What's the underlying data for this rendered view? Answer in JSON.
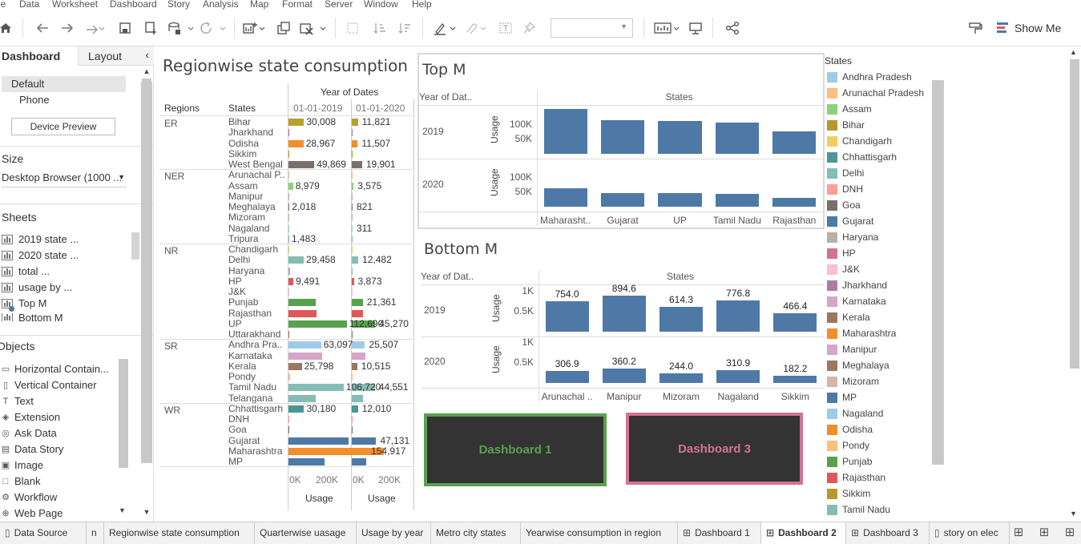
{
  "menu": [
    "le",
    "Data",
    "Worksheet",
    "Dashboard",
    "Story",
    "Analysis",
    "Map",
    "Format",
    "Server",
    "Window",
    "Help"
  ],
  "toolbar": {
    "show_me": "Show Me",
    "icons": [
      "home-icon",
      "undo-icon",
      "redo-icon",
      "replay-icon",
      "save-icon",
      "new-datasource-icon",
      "pause-updates-icon",
      "refresh-icon",
      "new-worksheet-icon",
      "duplicate-sheet-icon",
      "clear-sheet-icon",
      "group-icon",
      "sort-ascending-icon",
      "sort-descending-icon",
      "highlight-icon",
      "attach-icon",
      "label-icon",
      "pin-icon",
      "fit-icon",
      "presentation-icon",
      "share-icon",
      "format-painter-icon"
    ]
  },
  "left_panel": {
    "tab_dashboard": "Dashboard",
    "tab_layout": "Layout",
    "collapse": "‹",
    "devices": [
      "Default",
      "Phone"
    ],
    "device_preview": "Device Preview",
    "size_heading": "Size",
    "size_value": "Desktop Browser (1000 ...",
    "sheets_heading": "Sheets",
    "sheets": [
      "2019 state ...",
      "2020 state ...",
      "total ...",
      "usage by ...",
      "Top M",
      "Bottom M"
    ],
    "objects_heading": "Objects",
    "objects": [
      "Horizontal Contain...",
      "Vertical Container",
      "Text",
      "Extension",
      "Ask Data",
      "Data Story",
      "Image",
      "Blank",
      "Workflow",
      "Web Page"
    ],
    "object_icons": [
      "horizontal-container-icon",
      "vertical-container-icon",
      "text-icon",
      "extension-icon",
      "ask-data-icon",
      "data-story-icon",
      "image-icon",
      "blank-icon",
      "workflow-icon",
      "web-page-icon"
    ]
  },
  "regionwise": {
    "title": "Regionwise state consumption",
    "year_header": "Year of Dates",
    "col_regions": "Regions",
    "col_states": "States",
    "col_2019": "01-01-2019",
    "col_2020": "01-01-2020",
    "axis_ticks_2019": [
      "0K",
      "200K"
    ],
    "axis_ticks_2020": [
      "0K",
      "200K"
    ],
    "axis_label_2019": "Usage",
    "axis_label_2020": "Usage",
    "regions": [
      {
        "name": "ER",
        "rows": [
          {
            "state": "Bihar",
            "color": "#b8a02c",
            "v2019": 30008,
            "v2020": 11821,
            "show2019": "30,008",
            "show2020": "11,821"
          },
          {
            "state": "Jharkhand",
            "color": "#b07aa1",
            "v2019": 1500,
            "v2020": 600,
            "show2019": "",
            "show2020": ""
          },
          {
            "state": "Odisha",
            "color": "#f28e2b",
            "v2019": 28967,
            "v2020": 11507,
            "show2019": "28,967",
            "show2020": "11,507"
          },
          {
            "state": "Sikkim",
            "color": "#b8a02c",
            "v2019": 400,
            "v2020": 180,
            "show2019": "",
            "show2020": ""
          },
          {
            "state": "West Bengal",
            "color": "#79706e",
            "v2019": 49869,
            "v2020": 19901,
            "show2019": "49,869",
            "show2020": "19,901"
          }
        ]
      },
      {
        "name": "NER",
        "rows": [
          {
            "state": "Arunachal P..",
            "color": "#ffbe7d",
            "v2019": 300,
            "v2020": 150,
            "show2019": "",
            "show2020": ""
          },
          {
            "state": "Assam",
            "color": "#8cd17d",
            "v2019": 8979,
            "v2020": 3575,
            "show2019": "8,979",
            "show2020": "3,575"
          },
          {
            "state": "Manipur",
            "color": "#d4a6c8",
            "v2019": 350,
            "v2020": 150,
            "show2019": "",
            "show2020": ""
          },
          {
            "state": "Meghalaya",
            "color": "#9d7660",
            "v2019": 2018,
            "v2020": 821,
            "show2019": "2,018",
            "show2020": "821"
          },
          {
            "state": "Mizoram",
            "color": "#d7b5a6",
            "v2019": 240,
            "v2020": 100,
            "show2019": "",
            "show2020": ""
          },
          {
            "state": "Nagaland",
            "color": "#a0cbe8",
            "v2019": 300,
            "v2020": 311,
            "show2019": "",
            "show2020": "311"
          },
          {
            "state": "Tripura",
            "color": "#86bcb6",
            "v2019": 1483,
            "v2020": 600,
            "show2019": "1,483",
            "show2020": ""
          }
        ]
      },
      {
        "name": "NR",
        "rows": [
          {
            "state": "Chandigarh",
            "color": "#f1ce63",
            "v2019": 1500,
            "v2020": 600,
            "show2019": "",
            "show2020": ""
          },
          {
            "state": "Delhi",
            "color": "#86bcb6",
            "v2019": 29458,
            "v2020": 12482,
            "show2019": "29,458",
            "show2020": "12,482"
          },
          {
            "state": "Haryana",
            "color": "#bab0ac",
            "v2019": 2500,
            "v2020": 1000,
            "show2019": "",
            "show2020": ""
          },
          {
            "state": "HP",
            "color": "#e15759",
            "v2019": 9491,
            "v2020": 3873,
            "show2019": "9,491",
            "show2020": "3,873"
          },
          {
            "state": "J&K",
            "color": "#fabfd2",
            "v2019": 2000,
            "v2020": 800,
            "show2019": "",
            "show2020": ""
          },
          {
            "state": "Punjab",
            "color": "#59a14f",
            "v2019": 52000,
            "v2020": 21361,
            "show2019": "",
            "show2020": "21,361"
          },
          {
            "state": "Rajasthan",
            "color": "#e15759",
            "v2019": 54000,
            "v2020": 22000,
            "show2019": "",
            "show2020": ""
          },
          {
            "state": "UP",
            "color": "#59a14f",
            "v2019": 112690,
            "v2020": 45270,
            "show2019": "112,690",
            "show2020": "45,270"
          },
          {
            "state": "Uttarakhand",
            "color": "#9d7660",
            "v2019": 2000,
            "v2020": 800,
            "show2019": "",
            "show2020": ""
          }
        ]
      },
      {
        "name": "SR",
        "rows": [
          {
            "state": "Andhra Pra..",
            "color": "#a0cbe8",
            "v2019": 63097,
            "v2020": 25507,
            "show2019": "63,097",
            "show2020": "25,507"
          },
          {
            "state": "Karnataka",
            "color": "#d4a6c8",
            "v2019": 65000,
            "v2020": 26000,
            "show2019": "",
            "show2020": ""
          },
          {
            "state": "Kerala",
            "color": "#9d7660",
            "v2019": 25798,
            "v2020": 10515,
            "show2019": "25,798",
            "show2020": "10,515"
          },
          {
            "state": "Pondy",
            "color": "#ffbe7d",
            "v2019": 2500,
            "v2020": 1000,
            "show2019": "",
            "show2020": ""
          },
          {
            "state": "Tamil Nadu",
            "color": "#86bcb6",
            "v2019": 106720,
            "v2020": 44551,
            "show2019": "106,720",
            "show2020": "44,551"
          },
          {
            "state": "Telangana",
            "color": "#86bcb6",
            "v2019": 52000,
            "v2020": 21000,
            "show2019": "",
            "show2020": ""
          }
        ]
      },
      {
        "name": "WR",
        "rows": [
          {
            "state": "Chhattisgarh",
            "color": "#499894",
            "v2019": 30180,
            "v2020": 12010,
            "show2019": "30,180",
            "show2020": "12,010"
          },
          {
            "state": "DNH",
            "color": "#ff9d9a",
            "v2019": 500,
            "v2020": 200,
            "show2019": "",
            "show2020": ""
          },
          {
            "state": "Goa",
            "color": "#79706e",
            "v2019": 600,
            "v2020": 250,
            "show2019": "",
            "show2020": ""
          },
          {
            "state": "Gujarat",
            "color": "#4e79a7",
            "v2019": 116000,
            "v2020": 47131,
            "show2019": "",
            "show2020": "47,131"
          },
          {
            "state": "Maharashtra",
            "color": "#f28e2b",
            "v2019": 154917,
            "v2020": 62000,
            "show2019": "154,917",
            "show2020": ""
          },
          {
            "state": "MP",
            "color": "#4e79a7",
            "v2019": 70000,
            "v2020": 28000,
            "show2019": "",
            "show2020": ""
          }
        ]
      }
    ]
  },
  "top_m": {
    "title": "Top M",
    "col_year": "Year of Dat..",
    "col_states": "States",
    "y_label": "Usage",
    "ticks": [
      "100K",
      "50K"
    ],
    "years": [
      "2019",
      "2020"
    ],
    "categories": [
      "Maharasht..",
      "Gujarat",
      "UP",
      "Tamil Nadu",
      "Rajasthan"
    ]
  },
  "bottom_m": {
    "title": "Bottom M",
    "col_year": "Year of Dat..",
    "col_states": "States",
    "y_label": "Usage",
    "ticks": [
      "1K",
      "0.5K"
    ],
    "years": [
      "2019",
      "2020"
    ],
    "categories": [
      "Arunachal ..",
      "Manipur",
      "Mizoram",
      "Nagaland",
      "Sikkim"
    ]
  },
  "chart_data": [
    {
      "type": "bar",
      "title": "Top M",
      "xlabel": "States",
      "ylabel": "Usage",
      "categories": [
        "Maharasht..",
        "Gujarat",
        "UP",
        "Tamil Nadu",
        "Rajasthan"
      ],
      "series": [
        {
          "name": "2019",
          "values": [
            154917,
            116000,
            112690,
            106720,
            77000
          ]
        },
        {
          "name": "2020",
          "values": [
            62000,
            47131,
            45270,
            44551,
            30000
          ]
        }
      ],
      "ylim": [
        0,
        170000
      ]
    },
    {
      "type": "bar",
      "title": "Bottom M",
      "xlabel": "States",
      "ylabel": "Usage",
      "categories": [
        "Arunachal ..",
        "Manipur",
        "Mizoram",
        "Nagaland",
        "Sikkim"
      ],
      "series": [
        {
          "name": "2019",
          "values": [
            754.0,
            894.6,
            614.3,
            776.8,
            466.4
          ],
          "labels": [
            "754.0",
            "894.6",
            "614.3",
            "776.8",
            "466.4"
          ]
        },
        {
          "name": "2020",
          "values": [
            306.9,
            360.2,
            244.0,
            310.9,
            182.2
          ],
          "labels": [
            "306.9",
            "360.2",
            "244.0",
            "310.9",
            "182.2"
          ]
        }
      ],
      "ylim": [
        0,
        1100
      ]
    }
  ],
  "buttons": [
    {
      "label": "Dashboard 1",
      "color": "#59a14f"
    },
    {
      "label": "Dashboard 3",
      "color": "#d37295"
    }
  ],
  "legend": {
    "title": "States",
    "items": [
      {
        "label": "Andhra Pradesh",
        "color": "#a0cbe8"
      },
      {
        "label": "Arunachal Pradesh",
        "color": "#ffbe7d"
      },
      {
        "label": "Assam",
        "color": "#8cd17d"
      },
      {
        "label": "Bihar",
        "color": "#b6992d"
      },
      {
        "label": "Chandigarh",
        "color": "#f1ce63"
      },
      {
        "label": "Chhattisgarh",
        "color": "#499894"
      },
      {
        "label": "Delhi",
        "color": "#86bcb6"
      },
      {
        "label": "DNH",
        "color": "#ff9d9a"
      },
      {
        "label": "Goa",
        "color": "#79706e"
      },
      {
        "label": "Gujarat",
        "color": "#4e79a7"
      },
      {
        "label": "Haryana",
        "color": "#bab0ac"
      },
      {
        "label": "HP",
        "color": "#d37295"
      },
      {
        "label": "J&K",
        "color": "#fabfd2"
      },
      {
        "label": "Jharkhand",
        "color": "#b07aa1"
      },
      {
        "label": "Karnataka",
        "color": "#d4a6c8"
      },
      {
        "label": "Kerala",
        "color": "#9d7660"
      },
      {
        "label": "Maharashtra",
        "color": "#f28e2b"
      },
      {
        "label": "Manipur",
        "color": "#d4a6c8"
      },
      {
        "label": "Meghalaya",
        "color": "#9d7660"
      },
      {
        "label": "Mizoram",
        "color": "#d7b5a6"
      },
      {
        "label": "MP",
        "color": "#4e79a7"
      },
      {
        "label": "Nagaland",
        "color": "#a0cbe8"
      },
      {
        "label": "Odisha",
        "color": "#f28e2b"
      },
      {
        "label": "Pondy",
        "color": "#ffbe7d"
      },
      {
        "label": "Punjab",
        "color": "#59a14f"
      },
      {
        "label": "Rajasthan",
        "color": "#e15759"
      },
      {
        "label": "Sikkim",
        "color": "#b6992d"
      },
      {
        "label": "Tamil Nadu",
        "color": "#86bcb6"
      }
    ]
  },
  "bottom_tabs": [
    {
      "label": "Data Source",
      "icon": "database-icon"
    },
    {
      "label": "n",
      "icon": ""
    },
    {
      "label": "Regionwise state consumption",
      "icon": ""
    },
    {
      "label": "Quarterwise uasage",
      "icon": ""
    },
    {
      "label": "Usage by year",
      "icon": ""
    },
    {
      "label": "Metro city states",
      "icon": ""
    },
    {
      "label": "Yearwise consumption in region",
      "icon": ""
    },
    {
      "label": "Dashboard 1",
      "icon": "dashboard-icon"
    },
    {
      "label": "Dashboard 2",
      "icon": "dashboard-icon",
      "active": true
    },
    {
      "label": "Dashboard 3",
      "icon": "dashboard-icon"
    },
    {
      "label": "story on elec",
      "icon": "story-icon"
    }
  ]
}
